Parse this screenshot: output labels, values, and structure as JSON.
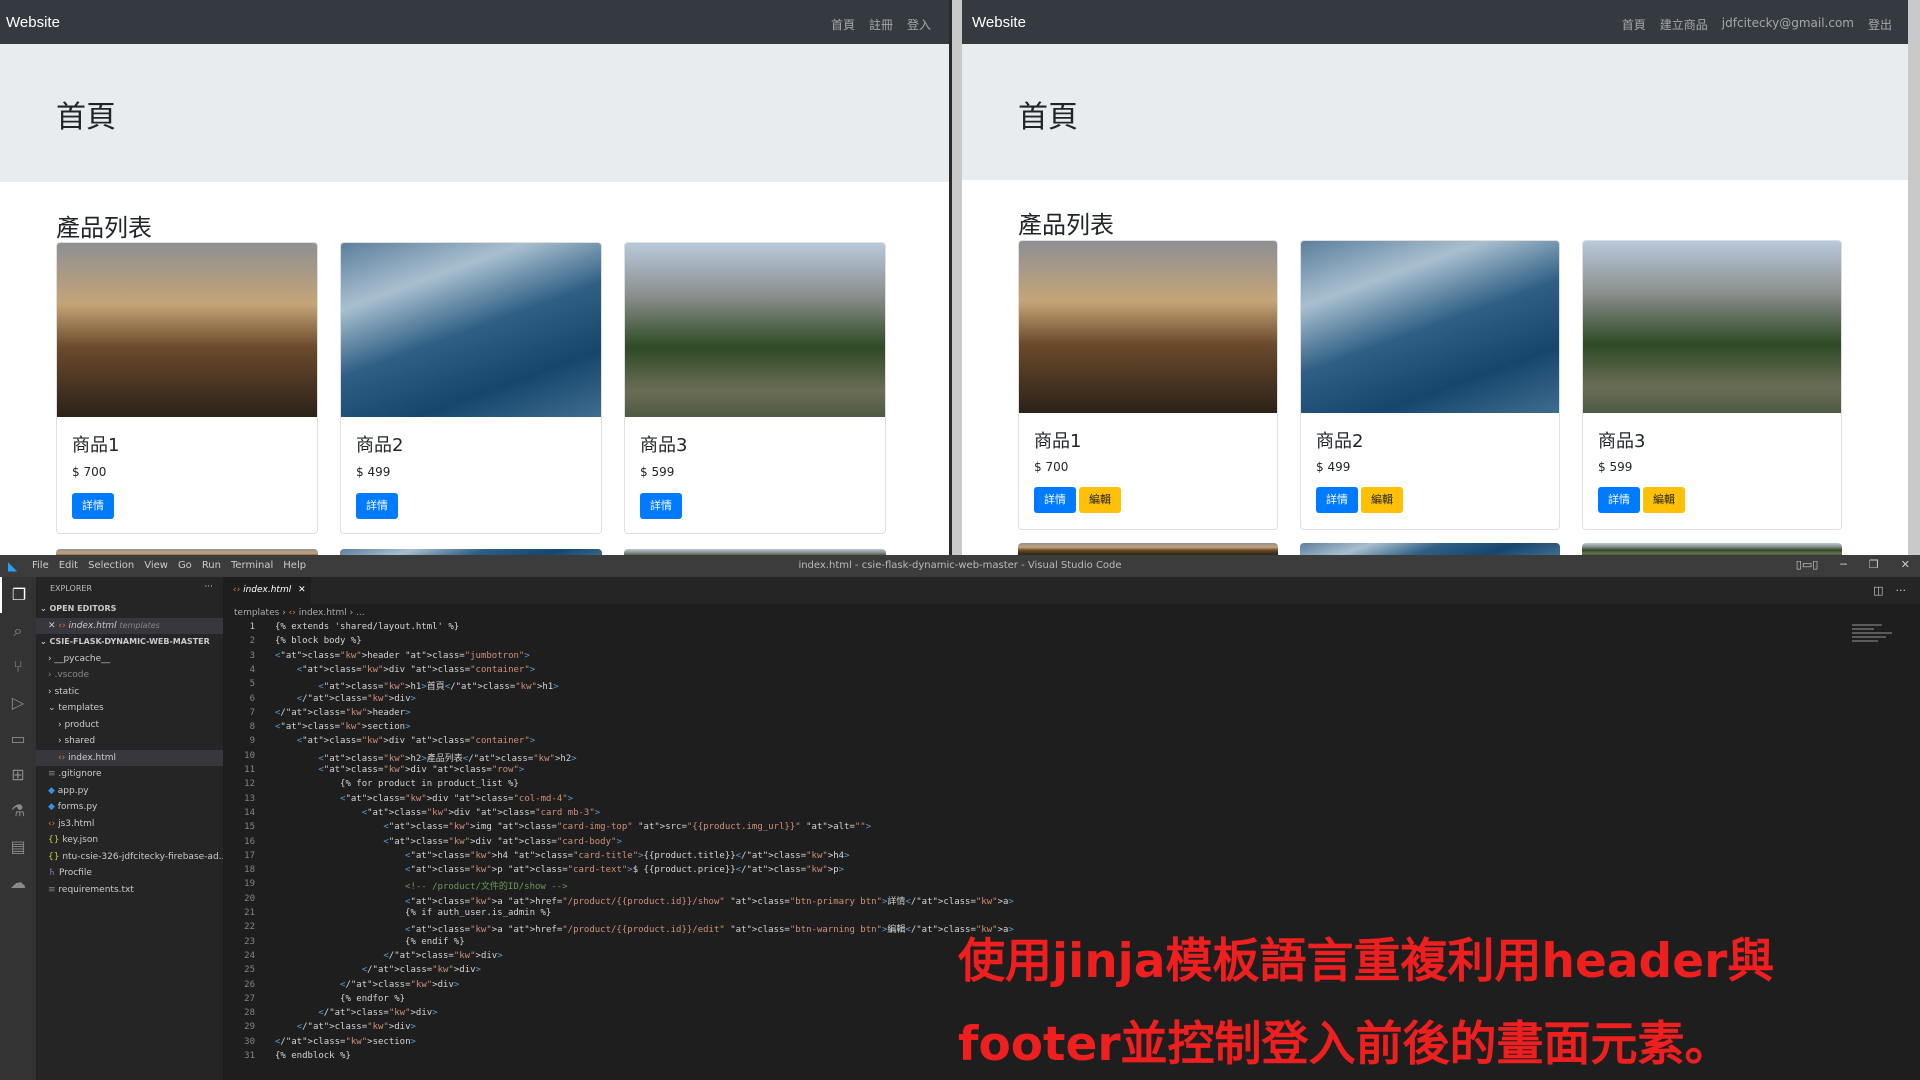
{
  "browser_left": {
    "brand": "Website",
    "nav_links": [
      "首頁",
      "註冊",
      "登入"
    ],
    "jumbotron_title": "首頁",
    "section_title": "產品列表",
    "products": [
      {
        "title": "商品1",
        "price": "$ 700",
        "detail_label": "詳情"
      },
      {
        "title": "商品2",
        "price": "$ 499",
        "detail_label": "詳情"
      },
      {
        "title": "商品3",
        "price": "$ 599",
        "detail_label": "詳情"
      }
    ]
  },
  "browser_right": {
    "brand": "Website",
    "nav_links": [
      "首頁",
      "建立商品",
      "jdfcitecky@gmail.com",
      "登出"
    ],
    "jumbotron_title": "首頁",
    "section_title": "產品列表",
    "products": [
      {
        "title": "商品1",
        "price": "$ 700",
        "detail_label": "詳情",
        "edit_label": "編輯"
      },
      {
        "title": "商品2",
        "price": "$ 499",
        "detail_label": "詳情",
        "edit_label": "編輯"
      },
      {
        "title": "商品3",
        "price": "$ 599",
        "detail_label": "詳情",
        "edit_label": "編輯"
      }
    ]
  },
  "vscode": {
    "menu": [
      "File",
      "Edit",
      "Selection",
      "View",
      "Go",
      "Run",
      "Terminal",
      "Help"
    ],
    "window_title": "index.html - csie-flask-dynamic-web-master - Visual Studio Code",
    "explorer_title": "EXPLORER",
    "open_editors_title": "OPEN EDITORS",
    "open_editor_item": "index.html",
    "open_editor_folder": "templates",
    "project_title": "CSIE-FLASK-DYNAMIC-WEB-MASTER",
    "tree": [
      "__pycache__",
      ".vscode",
      "static",
      "templates",
      "product",
      "shared",
      "index.html",
      ".gitignore",
      "app.py",
      "forms.py",
      "js3.html",
      "key.json",
      "ntu-csie-326-jdfcitecky-firebase-ad...",
      "Procfile",
      "requirements.txt"
    ],
    "tab_label": "index.html",
    "breadcrumb": [
      "templates",
      "index.html",
      "..."
    ],
    "line_numbers": [
      "1",
      "2",
      "3",
      "4",
      "5",
      "6",
      "7",
      "8",
      "9",
      "10",
      "11",
      "12",
      "13",
      "14",
      "15",
      "16",
      "17",
      "18",
      "19",
      "20",
      "21",
      "22",
      "23",
      "24",
      "25",
      "26",
      "27",
      "28",
      "29",
      "30",
      "31"
    ],
    "code_lines": [
      "{% extends 'shared/layout.html' %}",
      "{% block body %}",
      "<header class=\"jumbotron\">",
      "    <div class=\"container\">",
      "        <h1>首頁</h1>",
      "    </div>",
      "</header>",
      "<section>",
      "    <div class=\"container\">",
      "        <h2>產品列表</h2>",
      "        <div class=\"row\">",
      "            {% for product in product_list %}",
      "            <div class=\"col-md-4\">",
      "                <div class=\"card mb-3\">",
      "                    <img class=\"card-img-top\" src=\"{{product.img_url}}\" alt=\"\">",
      "                    <div class=\"card-body\">",
      "                        <h4 class=\"card-title\">{{product.title}}</h4>",
      "                        <p class=\"card-text\">$ {{product.price}}</p>",
      "                        <!-- /product/文件的ID/show -->",
      "                        <a href=\"/product/{{product.id}}/show\" class=\"btn-primary btn\">詳情</a>",
      "                        {% if auth_user.is_admin %}",
      "                        <a href=\"/product/{{product.id}}/edit\" class=\"btn-warning btn\">編輯</a>",
      "                        {% endif %}",
      "                    </div>",
      "                </div>",
      "            </div>",
      "            {% endfor %}",
      "        </div>",
      "    </div>",
      "</section>",
      "{% endblock %}"
    ]
  },
  "overlay": {
    "line1": "使用jinja模板語言重複利用header與",
    "line2": "footer並控制登入前後的畫面元素。"
  }
}
